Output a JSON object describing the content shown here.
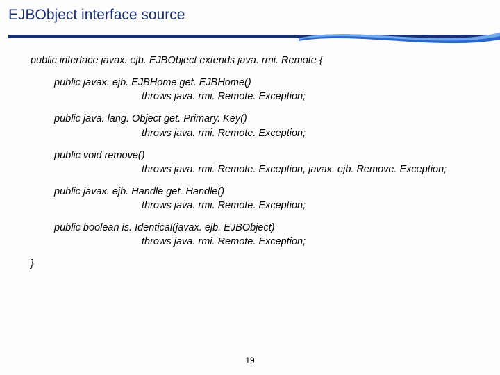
{
  "title": "EJBObject interface source",
  "page_number": "19",
  "code": {
    "decl": "public interface javax. ejb. EJBObject extends java. rmi. Remote {",
    "m1a": "public javax. ejb. EJBHome get. EJBHome()",
    "m1b": "throws java. rmi. Remote. Exception;",
    "m2a": "public java. lang. Object get. Primary. Key()",
    "m2b": "throws java. rmi. Remote. Exception;",
    "m3a": "public void remove()",
    "m3b": "throws java. rmi. Remote. Exception, javax. ejb. Remove. Exception;",
    "m4a": "public javax. ejb. Handle get. Handle()",
    "m4b": "throws java. rmi. Remote. Exception;",
    "m5a": "public boolean is. Identical(javax. ejb. EJBObject)",
    "m5b": "throws java. rmi. Remote. Exception;",
    "close": "}"
  }
}
